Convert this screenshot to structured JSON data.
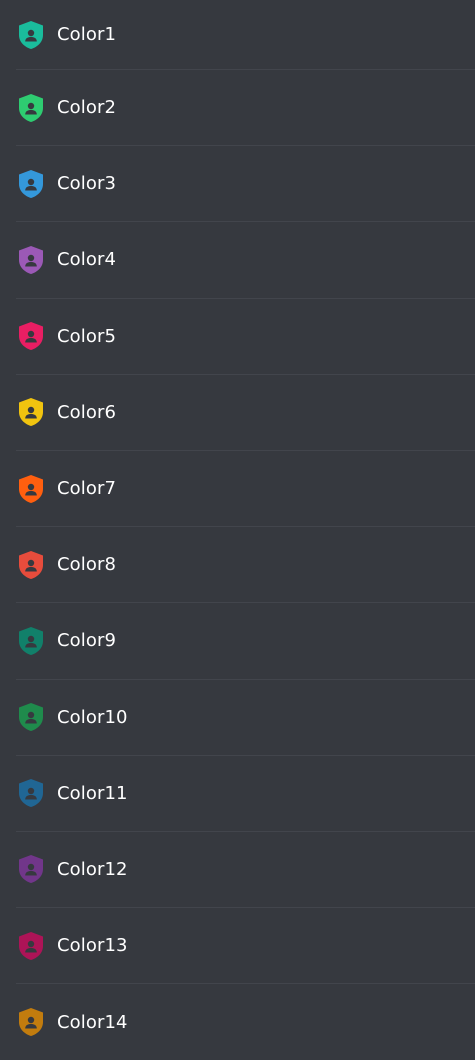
{
  "roles": [
    {
      "name": "Color1",
      "color": "#1abc9c",
      "icon": "shield-person-icon"
    },
    {
      "name": "Color2",
      "color": "#2ecc71",
      "icon": "shield-person-icon"
    },
    {
      "name": "Color3",
      "color": "#3498db",
      "icon": "shield-person-icon"
    },
    {
      "name": "Color4",
      "color": "#9b59b6",
      "icon": "shield-person-icon"
    },
    {
      "name": "Color5",
      "color": "#e91e63",
      "icon": "shield-person-icon"
    },
    {
      "name": "Color6",
      "color": "#f1c40f",
      "icon": "shield-person-icon"
    },
    {
      "name": "Color7",
      "color": "#ff5f0f",
      "icon": "shield-person-icon"
    },
    {
      "name": "Color8",
      "color": "#e74c3c",
      "icon": "shield-person-icon"
    },
    {
      "name": "Color9",
      "color": "#11806a",
      "icon": "shield-person-icon"
    },
    {
      "name": "Color10",
      "color": "#1f8b4c",
      "icon": "shield-person-icon"
    },
    {
      "name": "Color11",
      "color": "#206694",
      "icon": "shield-person-icon"
    },
    {
      "name": "Color12",
      "color": "#71368a",
      "icon": "shield-person-icon"
    },
    {
      "name": "Color13",
      "color": "#ad1457",
      "icon": "shield-person-icon"
    },
    {
      "name": "Color14",
      "color": "#c27c0e",
      "icon": "shield-person-icon"
    }
  ],
  "icon_glyph_color": "#36393f"
}
